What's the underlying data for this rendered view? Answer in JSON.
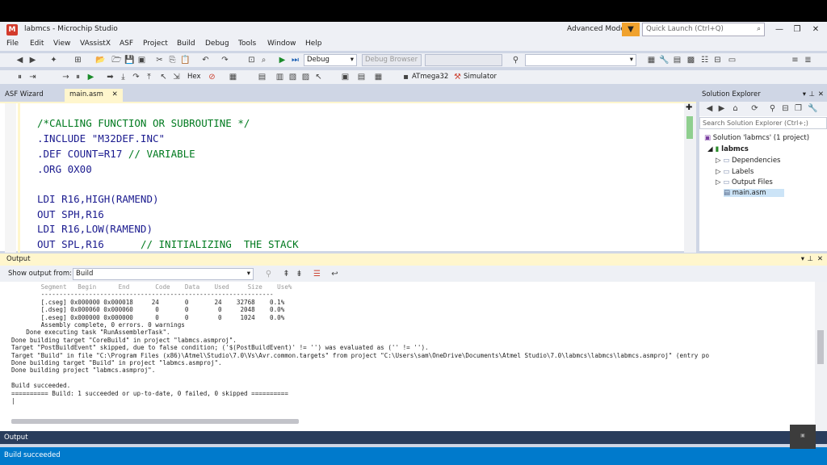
{
  "window": {
    "title": "labmcs - Microchip Studio",
    "advanced_mode": "Advanced Mode",
    "quick_launch_placeholder": "Quick Launch (Ctrl+Q)"
  },
  "menu": [
    "File",
    "Edit",
    "View",
    "VAssistX",
    "ASF",
    "Project",
    "Build",
    "Debug",
    "Tools",
    "Window",
    "Help"
  ],
  "toolbar": {
    "config": "Debug",
    "debug_browser": "Debug Browser",
    "hex_label": "Hex",
    "device": "ATmega32",
    "tool": "Simulator"
  },
  "tabs": {
    "asf_wizard": "ASF Wizard",
    "main_asm": "main.asm"
  },
  "code": [
    {
      "text": "/*CALLING FUNCTION OR SUBROUTINE */",
      "kind": "comment"
    },
    {
      "text": ".INCLUDE \"M32DEF.INC\"",
      "kind": "default"
    },
    {
      "text": ".DEF COUNT=R17 // VARIABLE",
      "kind": "mixed",
      "code": ".DEF COUNT=R17 ",
      "comment": "// VARIABLE"
    },
    {
      "text": ".ORG 0X00",
      "kind": "default"
    },
    {
      "text": "",
      "kind": "default"
    },
    {
      "text": "LDI R16,HIGH(RAMEND)",
      "kind": "default"
    },
    {
      "text": "OUT SPH,R16",
      "kind": "default"
    },
    {
      "text": "LDI R16,LOW(RAMEND)",
      "kind": "default"
    },
    {
      "text": "OUT SPL,R16      // INITIALIZING  THE STACK",
      "kind": "mixed",
      "code": "OUT SPL,R16      ",
      "comment": "// INITIALIZING  THE STACK"
    }
  ],
  "solution_explorer": {
    "title": "Solution Explorer",
    "search_placeholder": "Search Solution Explorer (Ctrl+;)",
    "solution": "Solution 'labmcs' (1 project)",
    "project": "labmcs",
    "items": [
      "Dependencies",
      "Labels",
      "Output Files",
      "main.asm"
    ]
  },
  "output": {
    "title": "Output",
    "show_from_label": "Show output from:",
    "show_from_value": "Build",
    "lines": [
      "        Segment   Begin      End       Code    Data    Used     Size    Use%",
      "        ---------------------------------------------------------------",
      "        [.cseg] 0x000000 0x000018     24       0       24    32768    0.1%",
      "        [.dseg] 0x000060 0x000060      0       0        0     2048    0.0%",
      "        [.eseg] 0x000000 0x000000      0       0        0     1024    0.0%",
      "        Assembly complete, 0 errors. 0 warnings",
      "    Done executing task \"RunAssemblerTask\".",
      "Done building target \"CoreBuild\" in project \"labmcs.asmproj\".",
      "Target \"PostBuildEvent\" skipped, due to false condition; ('$(PostBuildEvent)' != '') was evaluated as ('' != '').",
      "Target \"Build\" in file \"C:\\Program Files (x86)\\Atmel\\Studio\\7.0\\Vs\\Avr.common.targets\" from project \"C:\\Users\\sam\\OneDrive\\Documents\\Atmel Studio\\7.0\\labmcs\\labmcs\\labmcs.asmproj\" (entry po",
      "Done building target \"Build\" in project \"labmcs.asmproj\".",
      "Done building project \"labmcs.asmproj\".",
      "",
      "Build succeeded.",
      "========== Build: 1 succeeded or up-to-date, 0 failed, 0 skipped ==========",
      "|"
    ]
  },
  "bottom_tab": "Output",
  "status": "Build succeeded",
  "colors": {
    "accent": "#007acc",
    "active_tab": "#fff6cd",
    "comment": "#007a1f",
    "code": "#1b1b8f"
  }
}
